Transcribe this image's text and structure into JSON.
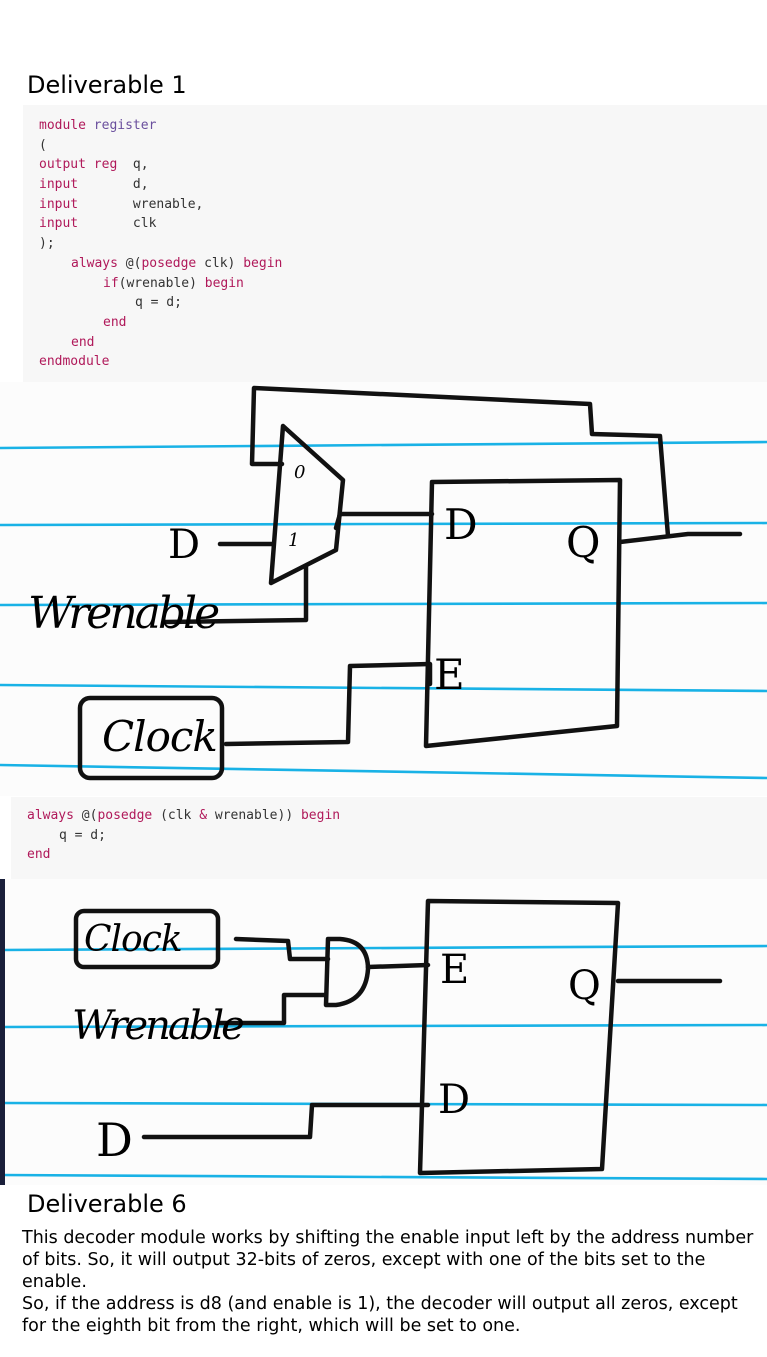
{
  "deliverable1": {
    "heading": "Deliverable 1",
    "code": {
      "l1": {
        "kw": "module",
        "name": "register"
      },
      "l2": "(",
      "l3": {
        "kw": "output reg",
        "rest": "  q,"
      },
      "l4": {
        "kw": "input",
        "rest": "       d,"
      },
      "l5": {
        "kw": "input",
        "rest": "       wrenable,"
      },
      "l6": {
        "kw": "input",
        "rest": "       clk"
      },
      "l7": ");",
      "l8": {
        "kw1": "always",
        "mid": " @(",
        "kw2": "posedge",
        "rest": " clk) ",
        "kw3": "begin"
      },
      "l9": {
        "kw1": "if",
        "mid": "(wrenable) ",
        "kw2": "begin"
      },
      "l10": "q = d;",
      "l11": "end",
      "l12": "end",
      "l13": "endmodule"
    },
    "sketch": {
      "mux_in0": "0",
      "mux_in1": "1",
      "d_label": "D",
      "wrenable_label": "Wrenable",
      "clock_label": "Clock",
      "ff_d": "D",
      "ff_e": "E",
      "ff_q": "Q"
    }
  },
  "alt_code": {
    "l1": {
      "kw1": "always",
      "mid1": " @(",
      "kw2": "posedge",
      "mid2": " (clk ",
      "op": "&",
      "mid3": " wrenable)) ",
      "kw3": "begin"
    },
    "l2": "q = d;",
    "l3": "end"
  },
  "sketch2": {
    "clock_label": "Clock",
    "wrenable_label": "Wrenable",
    "d_label": "D",
    "ff_e": "E",
    "ff_d": "D",
    "ff_q": "Q"
  },
  "deliverable6": {
    "heading": "Deliverable 6",
    "para1": "This decoder module works by shifting the enable input left by the address number of bits. So, it will output 32-bits of zeros, except with one of the bits set to the enable.",
    "para2": "So, if the address is d8 (and enable is 1), the decoder will output all zeros, except for the eighth bit from the right, which will be set to one."
  }
}
